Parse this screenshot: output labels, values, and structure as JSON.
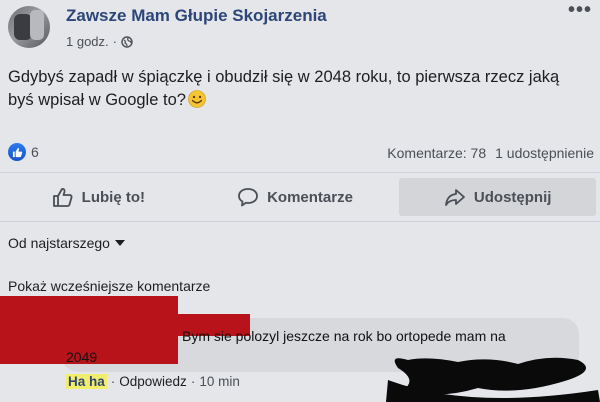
{
  "post": {
    "page_name": "Zawsze Mam Głupie Skojarzenia",
    "time": "1 godz.",
    "separator": "·",
    "text_line1": "Gdybyś zapadł w śpiączkę i obudził się w 2048 roku, to pierwsza rzecz jaką",
    "text_line2": "byś wpisał w Google to?"
  },
  "stats": {
    "reaction_count": "6",
    "comments": "Komentarze: 78",
    "shares": "1 udostępnienie"
  },
  "actions": {
    "like": "Lubię to!",
    "comment": "Komentarze",
    "share": "Udostępnij"
  },
  "comments_section": {
    "sort_label": "Od najstarszego",
    "show_more": "Pokaż wcześniejsze komentarze"
  },
  "comment": {
    "text_line1": "Bym sie polozyl jeszcze na rok bo ortopede mam na",
    "text_line2": "2049",
    "reaction": "Ha ha",
    "sep": "·",
    "reply": "Odpowiedz",
    "time": "10 min"
  },
  "colors": {
    "page_name": "#2d4677",
    "like_badge": "#1b62d6",
    "redaction": "#b8121b",
    "haha_highlight": "#f3ed6c"
  }
}
